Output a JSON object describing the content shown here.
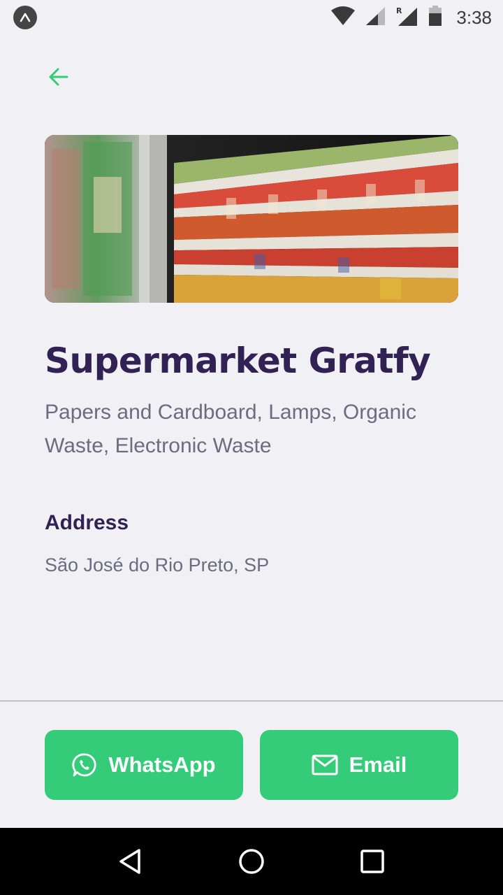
{
  "status_bar": {
    "time": "3:38",
    "icons": [
      "expo-icon",
      "wifi-icon",
      "signal-icon",
      "roaming-signal-icon",
      "battery-icon"
    ]
  },
  "header": {
    "back_icon": "arrow-left-icon"
  },
  "hero_image": {
    "subject": "supermarket-shelves-photo"
  },
  "point": {
    "title": "Supermarket Gratfy",
    "items": "Papers and Cardboard, Lamps, Organic Waste, Electronic Waste",
    "address_heading": "Address",
    "address_value": "São José do Rio Preto, SP"
  },
  "footer": {
    "whatsapp_label": "WhatsApp",
    "email_label": "Email"
  },
  "nav_bar": {
    "icons": [
      "back-triangle-icon",
      "home-circle-icon",
      "recents-square-icon"
    ]
  },
  "colors": {
    "accent": "#34cb79",
    "title": "#322153",
    "text": "#6c6c80",
    "background": "#f0f0f5"
  }
}
